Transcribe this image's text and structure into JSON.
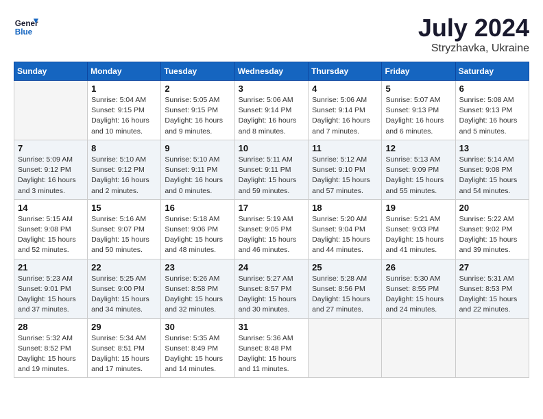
{
  "header": {
    "logo_line1": "General",
    "logo_line2": "Blue",
    "month_year": "July 2024",
    "location": "Stryzhavka, Ukraine"
  },
  "columns": [
    "Sunday",
    "Monday",
    "Tuesday",
    "Wednesday",
    "Thursday",
    "Friday",
    "Saturday"
  ],
  "weeks": [
    [
      {
        "day": "",
        "info": ""
      },
      {
        "day": "1",
        "info": "Sunrise: 5:04 AM\nSunset: 9:15 PM\nDaylight: 16 hours\nand 10 minutes."
      },
      {
        "day": "2",
        "info": "Sunrise: 5:05 AM\nSunset: 9:15 PM\nDaylight: 16 hours\nand 9 minutes."
      },
      {
        "day": "3",
        "info": "Sunrise: 5:06 AM\nSunset: 9:14 PM\nDaylight: 16 hours\nand 8 minutes."
      },
      {
        "day": "4",
        "info": "Sunrise: 5:06 AM\nSunset: 9:14 PM\nDaylight: 16 hours\nand 7 minutes."
      },
      {
        "day": "5",
        "info": "Sunrise: 5:07 AM\nSunset: 9:13 PM\nDaylight: 16 hours\nand 6 minutes."
      },
      {
        "day": "6",
        "info": "Sunrise: 5:08 AM\nSunset: 9:13 PM\nDaylight: 16 hours\nand 5 minutes."
      }
    ],
    [
      {
        "day": "7",
        "info": "Sunrise: 5:09 AM\nSunset: 9:12 PM\nDaylight: 16 hours\nand 3 minutes."
      },
      {
        "day": "8",
        "info": "Sunrise: 5:10 AM\nSunset: 9:12 PM\nDaylight: 16 hours\nand 2 minutes."
      },
      {
        "day": "9",
        "info": "Sunrise: 5:10 AM\nSunset: 9:11 PM\nDaylight: 16 hours\nand 0 minutes."
      },
      {
        "day": "10",
        "info": "Sunrise: 5:11 AM\nSunset: 9:11 PM\nDaylight: 15 hours\nand 59 minutes."
      },
      {
        "day": "11",
        "info": "Sunrise: 5:12 AM\nSunset: 9:10 PM\nDaylight: 15 hours\nand 57 minutes."
      },
      {
        "day": "12",
        "info": "Sunrise: 5:13 AM\nSunset: 9:09 PM\nDaylight: 15 hours\nand 55 minutes."
      },
      {
        "day": "13",
        "info": "Sunrise: 5:14 AM\nSunset: 9:08 PM\nDaylight: 15 hours\nand 54 minutes."
      }
    ],
    [
      {
        "day": "14",
        "info": "Sunrise: 5:15 AM\nSunset: 9:08 PM\nDaylight: 15 hours\nand 52 minutes."
      },
      {
        "day": "15",
        "info": "Sunrise: 5:16 AM\nSunset: 9:07 PM\nDaylight: 15 hours\nand 50 minutes."
      },
      {
        "day": "16",
        "info": "Sunrise: 5:18 AM\nSunset: 9:06 PM\nDaylight: 15 hours\nand 48 minutes."
      },
      {
        "day": "17",
        "info": "Sunrise: 5:19 AM\nSunset: 9:05 PM\nDaylight: 15 hours\nand 46 minutes."
      },
      {
        "day": "18",
        "info": "Sunrise: 5:20 AM\nSunset: 9:04 PM\nDaylight: 15 hours\nand 44 minutes."
      },
      {
        "day": "19",
        "info": "Sunrise: 5:21 AM\nSunset: 9:03 PM\nDaylight: 15 hours\nand 41 minutes."
      },
      {
        "day": "20",
        "info": "Sunrise: 5:22 AM\nSunset: 9:02 PM\nDaylight: 15 hours\nand 39 minutes."
      }
    ],
    [
      {
        "day": "21",
        "info": "Sunrise: 5:23 AM\nSunset: 9:01 PM\nDaylight: 15 hours\nand 37 minutes."
      },
      {
        "day": "22",
        "info": "Sunrise: 5:25 AM\nSunset: 9:00 PM\nDaylight: 15 hours\nand 34 minutes."
      },
      {
        "day": "23",
        "info": "Sunrise: 5:26 AM\nSunset: 8:58 PM\nDaylight: 15 hours\nand 32 minutes."
      },
      {
        "day": "24",
        "info": "Sunrise: 5:27 AM\nSunset: 8:57 PM\nDaylight: 15 hours\nand 30 minutes."
      },
      {
        "day": "25",
        "info": "Sunrise: 5:28 AM\nSunset: 8:56 PM\nDaylight: 15 hours\nand 27 minutes."
      },
      {
        "day": "26",
        "info": "Sunrise: 5:30 AM\nSunset: 8:55 PM\nDaylight: 15 hours\nand 24 minutes."
      },
      {
        "day": "27",
        "info": "Sunrise: 5:31 AM\nSunset: 8:53 PM\nDaylight: 15 hours\nand 22 minutes."
      }
    ],
    [
      {
        "day": "28",
        "info": "Sunrise: 5:32 AM\nSunset: 8:52 PM\nDaylight: 15 hours\nand 19 minutes."
      },
      {
        "day": "29",
        "info": "Sunrise: 5:34 AM\nSunset: 8:51 PM\nDaylight: 15 hours\nand 17 minutes."
      },
      {
        "day": "30",
        "info": "Sunrise: 5:35 AM\nSunset: 8:49 PM\nDaylight: 15 hours\nand 14 minutes."
      },
      {
        "day": "31",
        "info": "Sunrise: 5:36 AM\nSunset: 8:48 PM\nDaylight: 15 hours\nand 11 minutes."
      },
      {
        "day": "",
        "info": ""
      },
      {
        "day": "",
        "info": ""
      },
      {
        "day": "",
        "info": ""
      }
    ]
  ]
}
